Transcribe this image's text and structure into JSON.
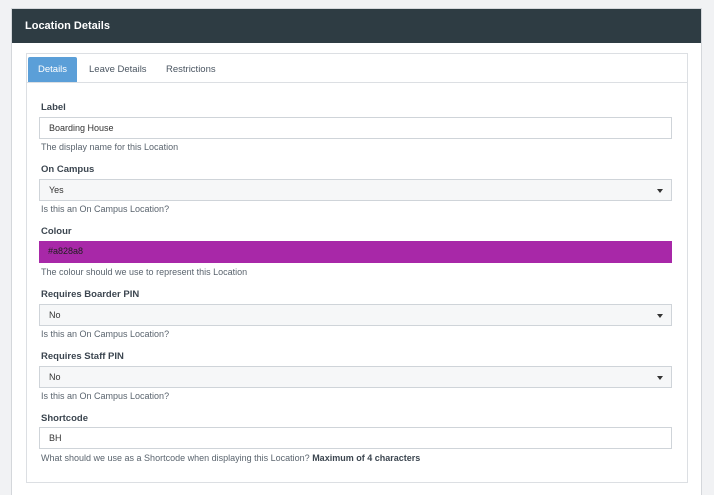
{
  "panel": {
    "title": "Location Details"
  },
  "tabs": [
    {
      "label": "Details",
      "active": true
    },
    {
      "label": "Leave Details",
      "active": false
    },
    {
      "label": "Restrictions",
      "active": false
    }
  ],
  "fields": {
    "label": {
      "label": "Label",
      "value": "Boarding House",
      "help": "The display name for this Location"
    },
    "on_campus": {
      "label": "On Campus",
      "value": "Yes",
      "help": "Is this an On Campus Location?"
    },
    "colour": {
      "label": "Colour",
      "value": "#a828a8",
      "swatch": "#a828a8",
      "help": "The colour should we use to represent this Location"
    },
    "requires_boarder_pin": {
      "label": "Requires Boarder PIN",
      "value": "No",
      "help": "Is this an On Campus Location?"
    },
    "requires_staff_pin": {
      "label": "Requires Staff PIN",
      "value": "No",
      "help": "Is this an On Campus Location?"
    },
    "shortcode": {
      "label": "Shortcode",
      "value": "BH",
      "help": "What should we use as a Shortcode when displaying this Location?",
      "help_bold": "Maximum of 4 characters"
    }
  },
  "colors": {
    "header_bg": "#2e3c43",
    "active_tab": "#5b9fd8",
    "colour_swatch": "#a828a8"
  },
  "icons": {
    "select_caret": "caret-down-icon"
  }
}
